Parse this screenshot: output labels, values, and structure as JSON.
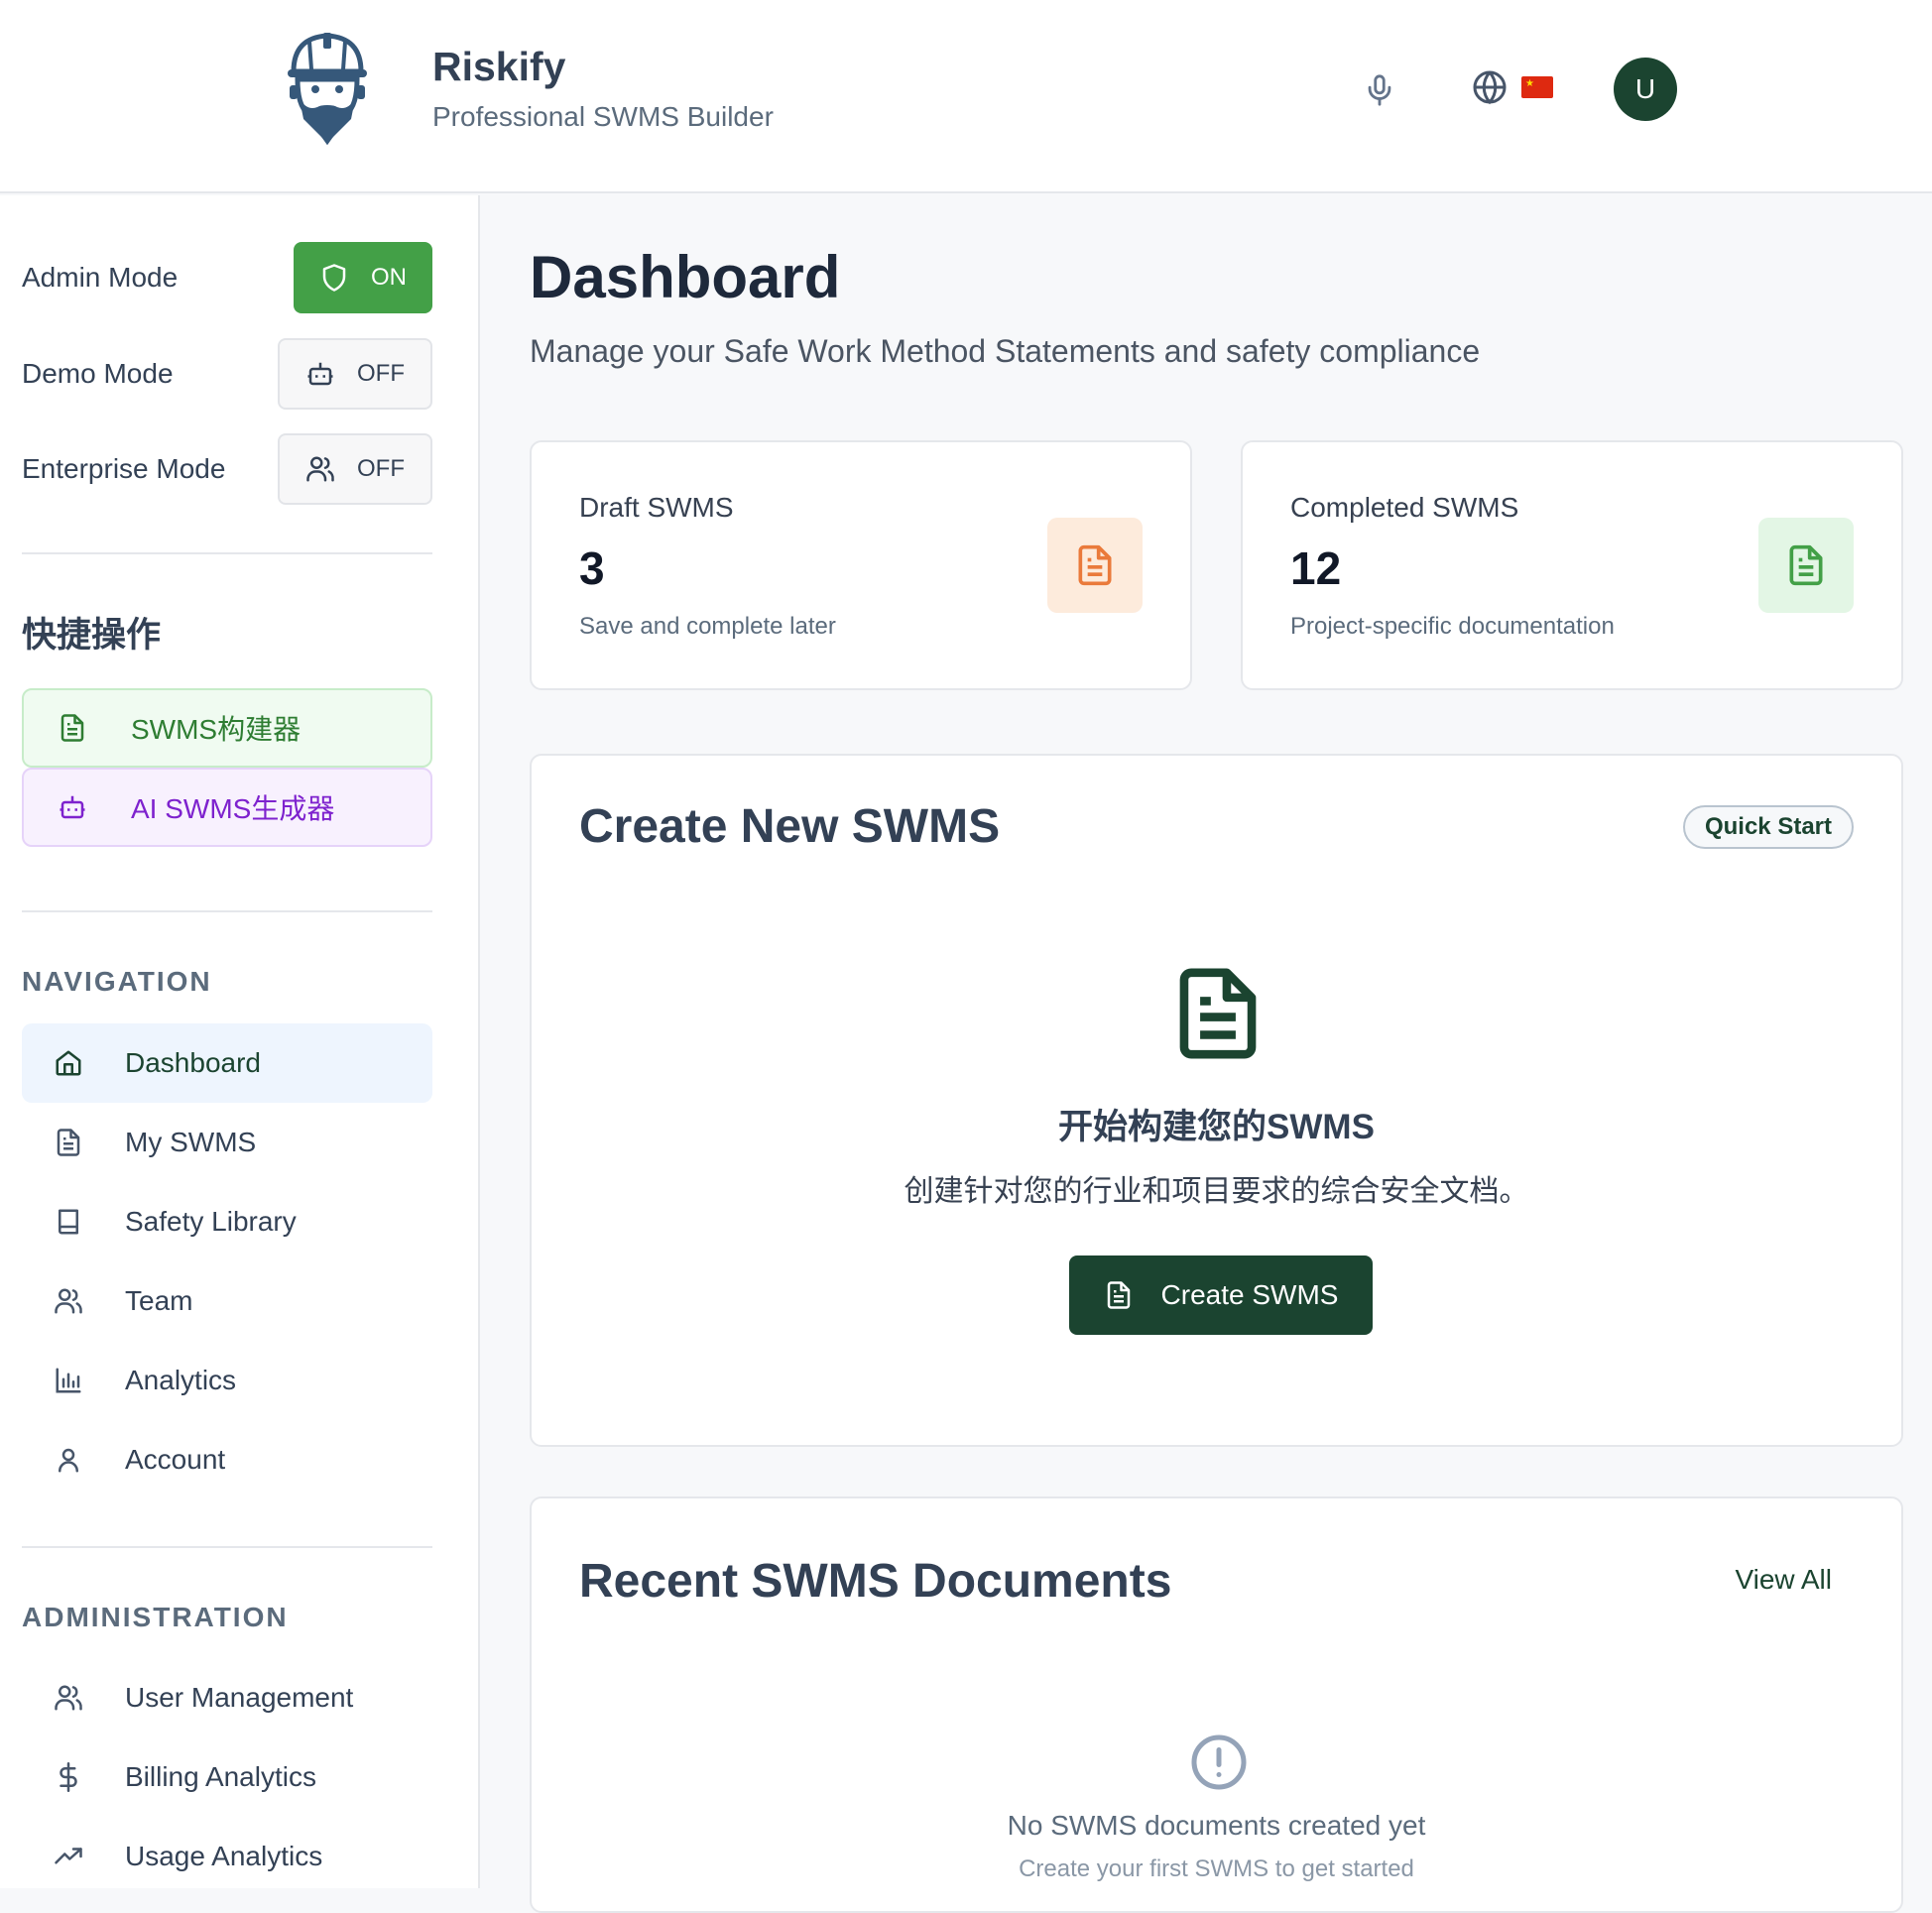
{
  "header": {
    "brand_title": "Riskify",
    "brand_subtitle": "Professional SWMS Builder",
    "avatar_initial": "U",
    "language_flag": "CN"
  },
  "sidebar": {
    "modes": [
      {
        "label": "Admin Mode",
        "state": "ON",
        "icon": "shield-icon"
      },
      {
        "label": "Demo Mode",
        "state": "OFF",
        "icon": "robot-icon"
      },
      {
        "label": "Enterprise Mode",
        "state": "OFF",
        "icon": "users-icon"
      }
    ],
    "quick_actions_title": "快捷操作",
    "quick_actions": [
      {
        "label": "SWMS构建器",
        "icon": "document-icon"
      },
      {
        "label": "AI SWMS生成器",
        "icon": "robot-icon"
      }
    ],
    "navigation_title": "NAVIGATION",
    "navigation": [
      {
        "label": "Dashboard",
        "icon": "home-icon",
        "active": true
      },
      {
        "label": "My SWMS",
        "icon": "document-icon"
      },
      {
        "label": "Safety Library",
        "icon": "book-icon"
      },
      {
        "label": "Team",
        "icon": "users-icon"
      },
      {
        "label": "Analytics",
        "icon": "bar-chart-icon"
      },
      {
        "label": "Account",
        "icon": "user-icon"
      }
    ],
    "administration_title": "ADMINISTRATION",
    "administration": [
      {
        "label": "User Management",
        "icon": "users-icon"
      },
      {
        "label": "Billing Analytics",
        "icon": "dollar-icon"
      },
      {
        "label": "Usage Analytics",
        "icon": "trending-up-icon"
      }
    ]
  },
  "main": {
    "title": "Dashboard",
    "subtitle": "Manage your Safe Work Method Statements and safety compliance",
    "stats": [
      {
        "label": "Draft SWMS",
        "value": "3",
        "description": "Save and complete later",
        "color": "#ea7a3b"
      },
      {
        "label": "Completed SWMS",
        "value": "12",
        "description": "Project-specific documentation",
        "color": "#43a047"
      }
    ],
    "create": {
      "title": "Create New SWMS",
      "badge": "Quick Start",
      "heading": "开始构建您的SWMS",
      "description": "创建针对您的行业和项目要求的综合安全文档。",
      "button_label": "Create SWMS"
    },
    "recent": {
      "title": "Recent SWMS Documents",
      "view_all": "View All",
      "empty_title": "No SWMS documents created yet",
      "empty_subtitle": "Create your first SWMS to get started"
    }
  },
  "colors": {
    "brand_dark_green": "#1b4430",
    "admin_on_green": "#43a047",
    "quick_purple": "#7e22ce",
    "draft_orange": "#ea7a3b"
  }
}
